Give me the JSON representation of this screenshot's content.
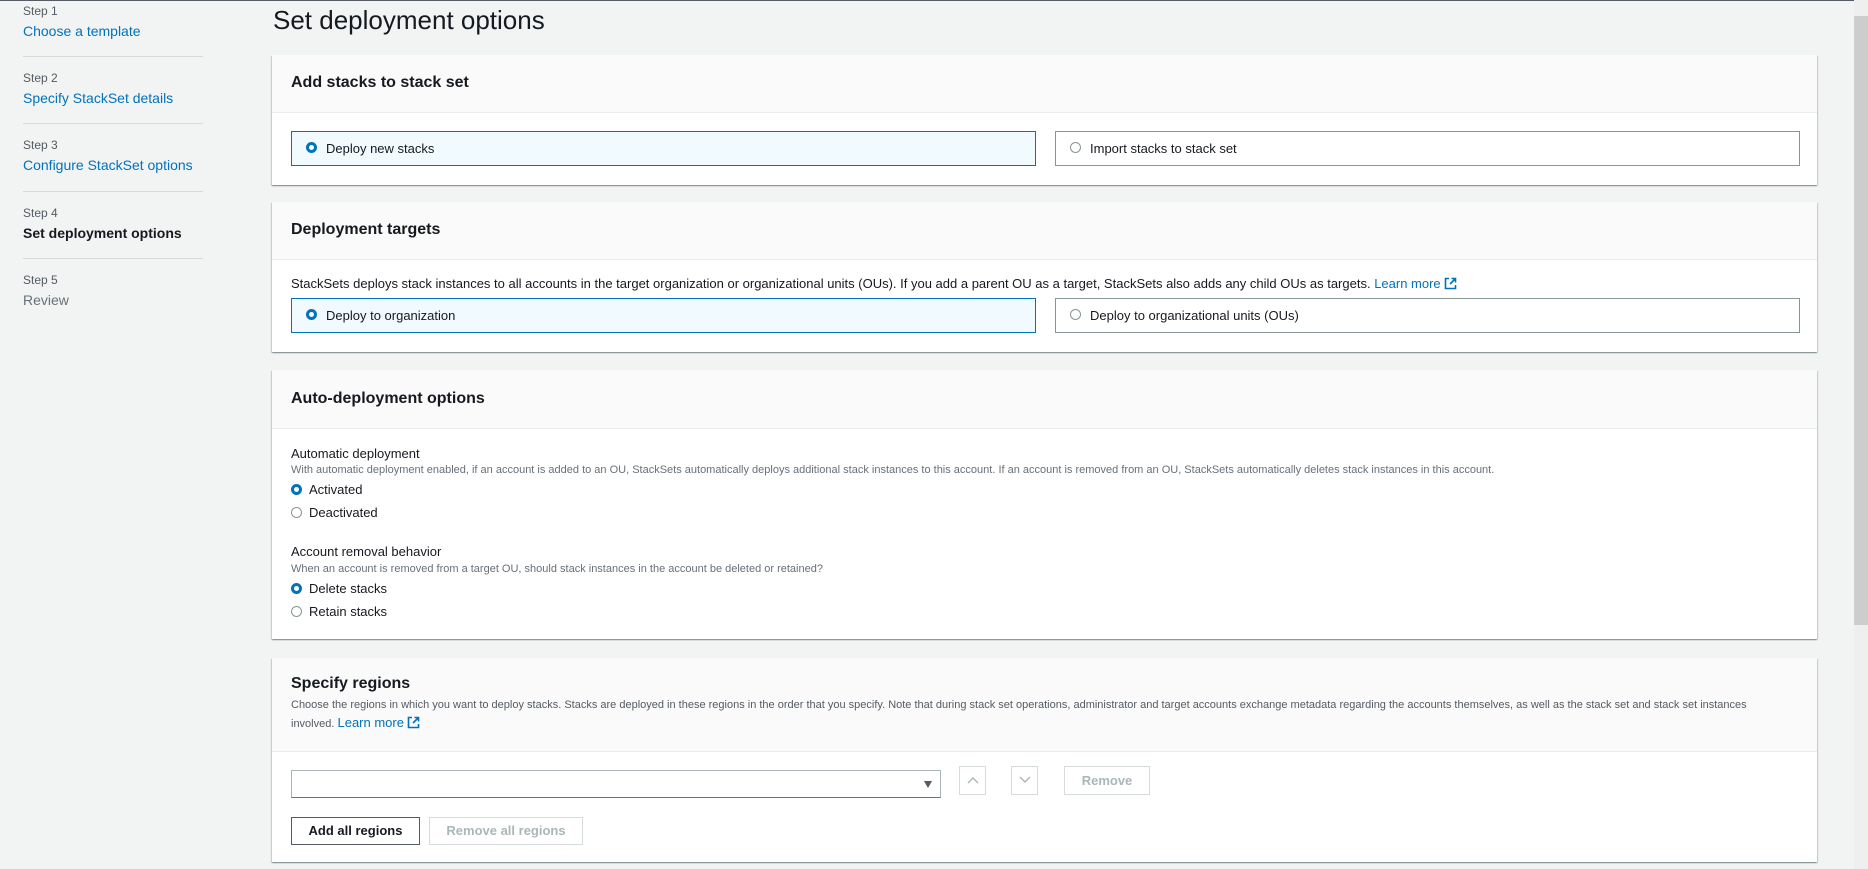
{
  "sidebar": {
    "steps": [
      {
        "step": "Step 1",
        "label": "Choose a template",
        "state": "link"
      },
      {
        "step": "Step 2",
        "label": "Specify StackSet details",
        "state": "link"
      },
      {
        "step": "Step 3",
        "label": "Configure StackSet options",
        "state": "link"
      },
      {
        "step": "Step 4",
        "label": "Set deployment options",
        "state": "current"
      },
      {
        "step": "Step 5",
        "label": "Review",
        "state": "disabled"
      }
    ]
  },
  "page_title": "Set deployment options",
  "add_stacks": {
    "title": "Add stacks to stack set",
    "options": [
      {
        "label": "Deploy new stacks",
        "selected": true
      },
      {
        "label": "Import stacks to stack set",
        "selected": false
      }
    ]
  },
  "deployment_targets": {
    "title": "Deployment targets",
    "description": "StackSets deploys stack instances to all accounts in the target organization or organizational units (OUs). If you add a parent OU as a target, StackSets also adds any child OUs as targets.",
    "learn_more": "Learn more",
    "options": [
      {
        "label": "Deploy to organization",
        "selected": true
      },
      {
        "label": "Deploy to organizational units (OUs)",
        "selected": false
      }
    ]
  },
  "auto_deployment": {
    "title": "Auto-deployment options",
    "automatic": {
      "label": "Automatic deployment",
      "description": "With automatic deployment enabled, if an account is added to an OU, StackSets automatically deploys additional stack instances to this account. If an account is removed from an OU, StackSets automatically deletes stack instances in this account.",
      "options": [
        {
          "label": "Activated",
          "selected": true
        },
        {
          "label": "Deactivated",
          "selected": false
        }
      ]
    },
    "removal": {
      "label": "Account removal behavior",
      "description": "When an account is removed from a target OU, should stack instances in the account be deleted or retained?",
      "options": [
        {
          "label": "Delete stacks",
          "selected": true
        },
        {
          "label": "Retain stacks",
          "selected": false
        }
      ]
    }
  },
  "regions": {
    "title": "Specify regions",
    "description_line1": "Choose the regions in which you want to deploy stacks. Stacks are deployed in these regions in the order that you specify. Note that during stack set operations, administrator and target accounts exchange metadata regarding the accounts themselves, as well as the stack set and stack set instances",
    "description_line2": "involved.",
    "learn_more": "Learn more",
    "select_value": "",
    "move_up_icon": "chevron-up",
    "move_down_icon": "chevron-down",
    "remove_label": "Remove",
    "add_all_label": "Add all regions",
    "remove_all_label": "Remove all regions"
  },
  "colors": {
    "accent": "#0073bb",
    "selected_tile_bg": "#f1faff",
    "page_bg": "#f2f3f3"
  }
}
